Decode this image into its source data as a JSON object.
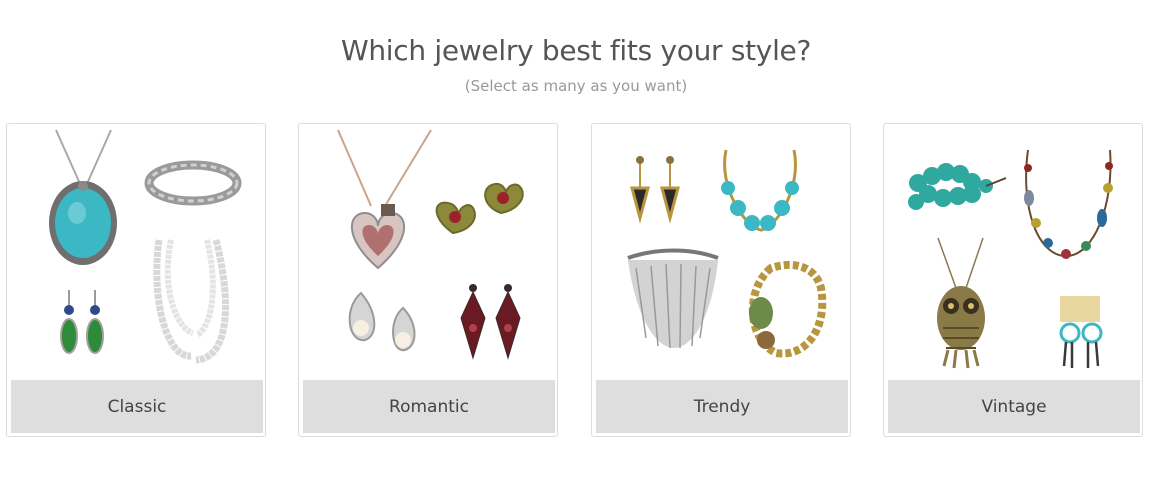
{
  "header": {
    "title": "Which jewelry best fits your style?",
    "subtitle": "(Select as many as you want)"
  },
  "options": [
    {
      "label": "Classic"
    },
    {
      "label": "Romantic"
    },
    {
      "label": "Trendy"
    },
    {
      "label": "Vintage"
    }
  ],
  "colors": {
    "turquoise": "#3cb7c4",
    "silver": "#c8c8c8",
    "gold": "#b8963e",
    "garnet": "#7a1f2a",
    "label_bg": "#dedede"
  }
}
